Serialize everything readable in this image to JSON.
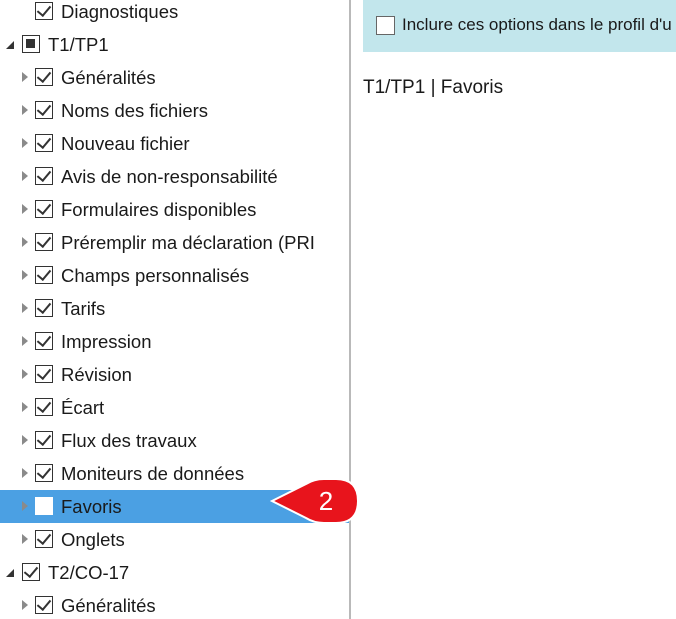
{
  "tree": {
    "items": [
      {
        "label": "Diagnostiques",
        "state": "checked",
        "arrow": "none",
        "level": 1
      },
      {
        "label": "T1/TP1",
        "state": "partial",
        "arrow": "expanded",
        "level": 0
      },
      {
        "label": "Généralités",
        "state": "checked",
        "arrow": "collapsed",
        "level": 1
      },
      {
        "label": "Noms des fichiers",
        "state": "checked",
        "arrow": "collapsed",
        "level": 1
      },
      {
        "label": "Nouveau fichier",
        "state": "checked",
        "arrow": "collapsed",
        "level": 1
      },
      {
        "label": "Avis de non-responsabilité",
        "state": "checked",
        "arrow": "collapsed",
        "level": 1
      },
      {
        "label": "Formulaires disponibles",
        "state": "checked",
        "arrow": "collapsed",
        "level": 1
      },
      {
        "label": "Préremplir ma déclaration (PRI",
        "state": "checked",
        "arrow": "collapsed",
        "level": 1
      },
      {
        "label": "Champs personnalisés",
        "state": "checked",
        "arrow": "collapsed",
        "level": 1
      },
      {
        "label": "Tarifs",
        "state": "checked",
        "arrow": "collapsed",
        "level": 1
      },
      {
        "label": "Impression",
        "state": "checked",
        "arrow": "collapsed",
        "level": 1
      },
      {
        "label": "Révision",
        "state": "checked",
        "arrow": "collapsed",
        "level": 1
      },
      {
        "label": "Écart",
        "state": "checked",
        "arrow": "collapsed",
        "level": 1
      },
      {
        "label": "Flux des travaux",
        "state": "checked",
        "arrow": "collapsed",
        "level": 1
      },
      {
        "label": "Moniteurs de données",
        "state": "checked",
        "arrow": "collapsed",
        "level": 1
      },
      {
        "label": "Favoris",
        "state": "unchecked",
        "arrow": "collapsed",
        "level": 1,
        "selected": true
      },
      {
        "label": "Onglets",
        "state": "checked",
        "arrow": "collapsed",
        "level": 1
      },
      {
        "label": "T2/CO-17",
        "state": "checked",
        "arrow": "expanded",
        "level": 0
      },
      {
        "label": "Généralités",
        "state": "checked",
        "arrow": "collapsed",
        "level": 1
      }
    ]
  },
  "info_bar": {
    "checkbox_label": "Inclure ces options dans le profil d'u",
    "checked": false
  },
  "content": {
    "heading": "T1/TP1 | Favoris"
  },
  "callout": {
    "number": "2",
    "color": "#e8141c"
  },
  "colors": {
    "selection": "#4ba0e3",
    "info_bar": "#c2e6ec"
  }
}
